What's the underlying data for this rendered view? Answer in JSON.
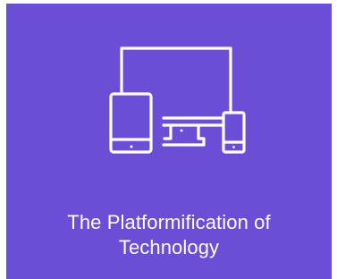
{
  "card": {
    "background_color": "#6a4fd6",
    "icon": "multi-device-icon",
    "title_lines": [
      "The Platformification of",
      "Technology"
    ]
  }
}
